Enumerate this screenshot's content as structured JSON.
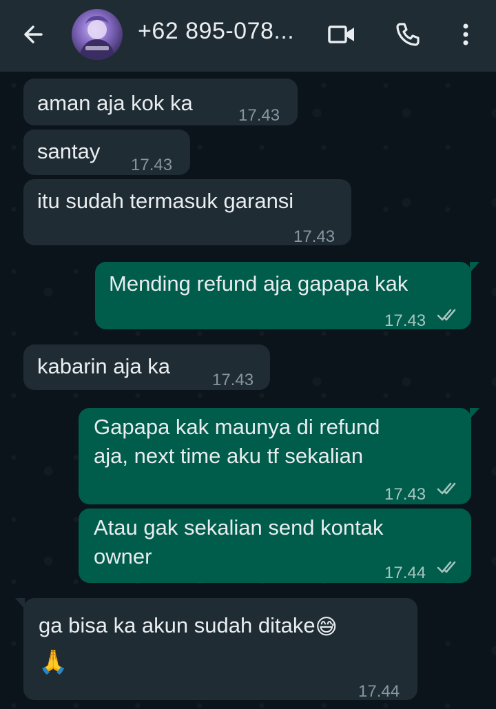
{
  "header": {
    "contact_name": "+62 895-078...",
    "icons": [
      "back-arrow-icon",
      "avatar",
      "video-call-icon",
      "phone-call-icon",
      "more-options-icon"
    ]
  },
  "colors": {
    "header_bg": "#1f2c34",
    "chat_bg": "#0b141a",
    "incoming_bubble": "#1f2c34",
    "outgoing_bubble": "#005c4b",
    "read_tick": "#a6c5bf"
  },
  "messages": [
    {
      "direction": "in",
      "text": "aman aja kok ka",
      "time": "17.43"
    },
    {
      "direction": "in",
      "text": "santay",
      "time": "17.43"
    },
    {
      "direction": "in",
      "text": "itu sudah termasuk garansi",
      "time": "17.43"
    },
    {
      "direction": "out",
      "text": "Mending refund aja gapapa kak",
      "time": "17.43",
      "status": "read"
    },
    {
      "direction": "in",
      "text": "kabarin aja ka",
      "time": "17.43"
    },
    {
      "direction": "out",
      "text_line1": "Gapapa kak maunya di refund",
      "text_line2": "aja, next time aku tf sekalian",
      "time": "17.43",
      "status": "read"
    },
    {
      "direction": "out",
      "text_line1": "Atau gak sekalian send kontak",
      "text_line2": "owner",
      "time": "17.44",
      "status": "read"
    },
    {
      "direction": "in",
      "text_line1": "ga bisa ka akun sudah ditake",
      "emoji1": "😅",
      "emoji2": "🙏",
      "time": "17.44"
    }
  ]
}
